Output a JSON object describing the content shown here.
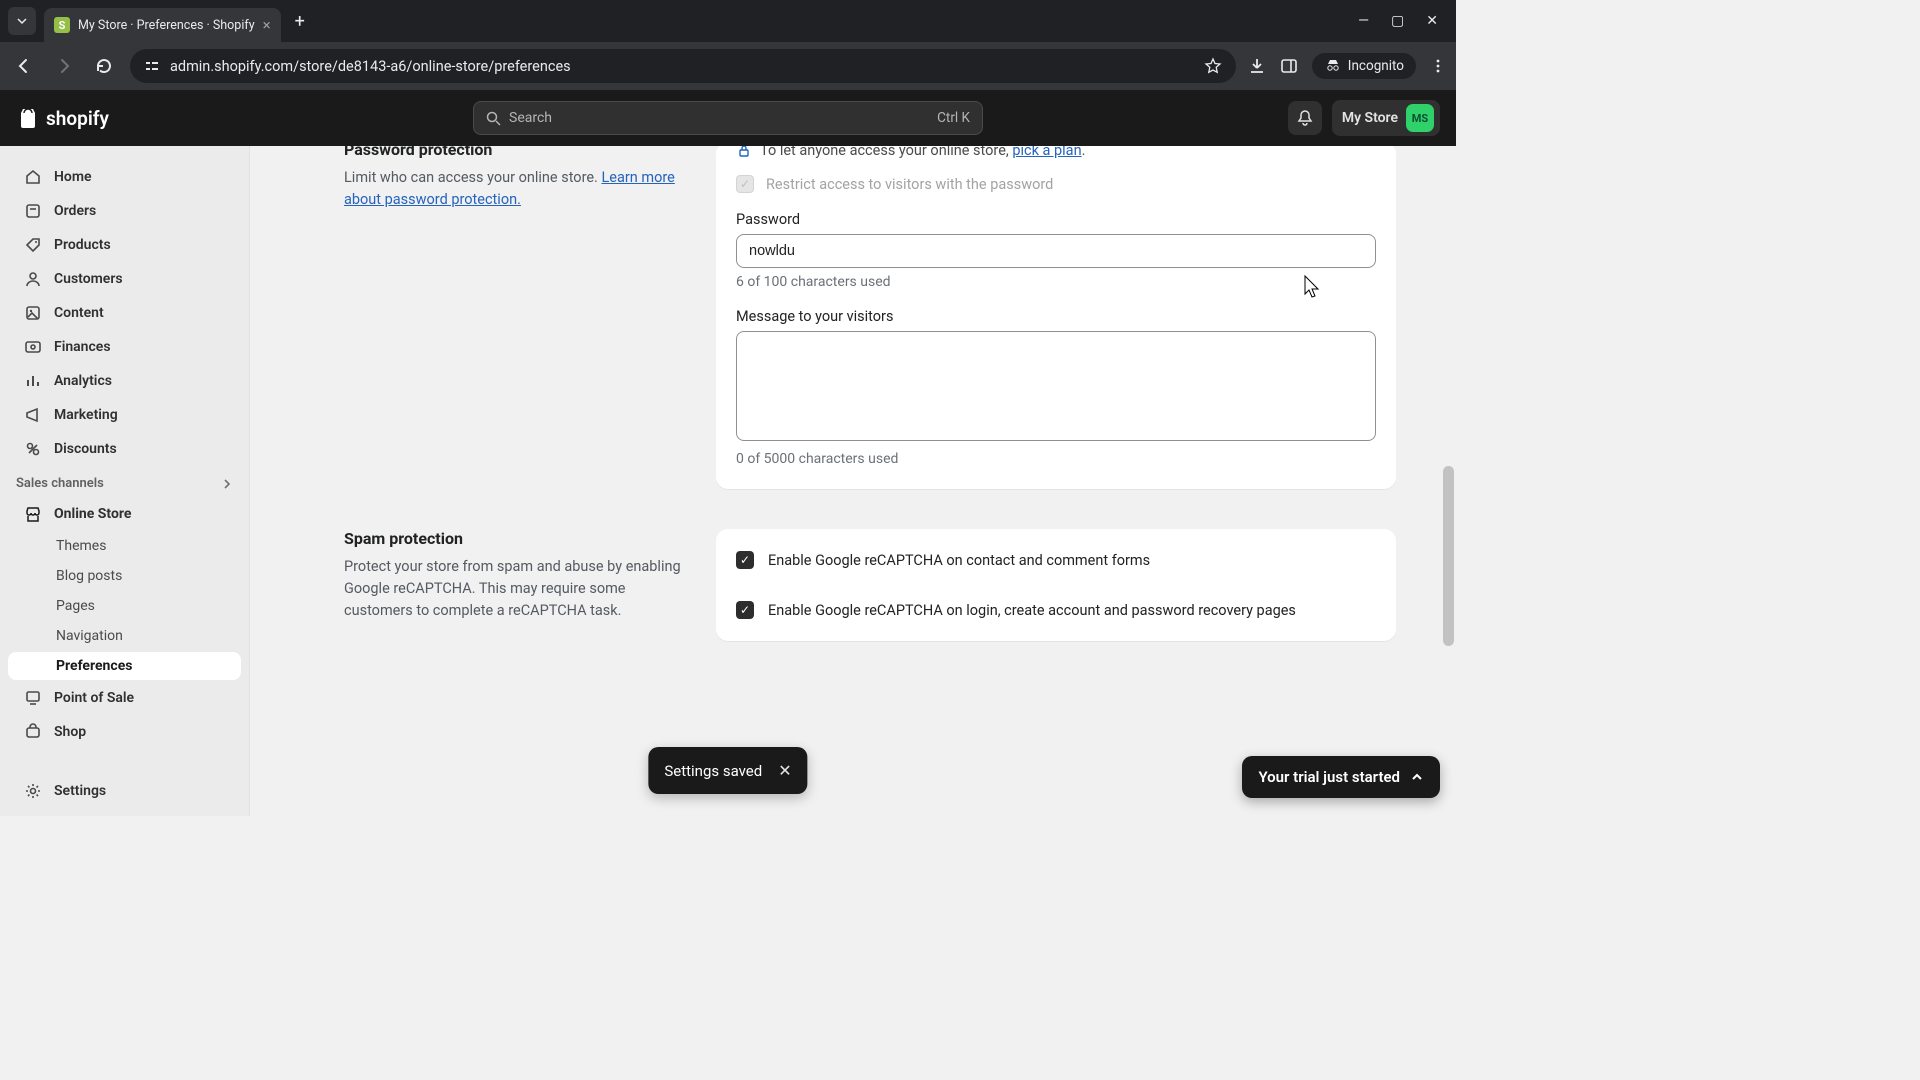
{
  "browser": {
    "tab_title": "My Store · Preferences · Shopify",
    "url": "admin.shopify.com/store/de8143-a6/online-store/preferences",
    "incognito": "Incognito"
  },
  "appbar": {
    "brand": "shopify",
    "search_placeholder": "Search",
    "search_kbd": "Ctrl K",
    "store_name": "My Store",
    "store_initials": "MS"
  },
  "sidebar": {
    "items": [
      {
        "label": "Home"
      },
      {
        "label": "Orders"
      },
      {
        "label": "Products"
      },
      {
        "label": "Customers"
      },
      {
        "label": "Content"
      },
      {
        "label": "Finances"
      },
      {
        "label": "Analytics"
      },
      {
        "label": "Marketing"
      },
      {
        "label": "Discounts"
      }
    ],
    "channels_header": "Sales channels",
    "online_store": "Online Store",
    "subitems": [
      {
        "label": "Themes"
      },
      {
        "label": "Blog posts"
      },
      {
        "label": "Pages"
      },
      {
        "label": "Navigation"
      },
      {
        "label": "Preferences"
      }
    ],
    "pos": "Point of Sale",
    "shop": "Shop",
    "settings": "Settings"
  },
  "password_section": {
    "title": "Password protection",
    "desc_prefix": "Limit who can access your online store. ",
    "desc_link": "Learn more about password protection.",
    "banner_prefix": "To let anyone access your online store, ",
    "banner_link": "pick a plan",
    "banner_suffix": ".",
    "restrict_label": "Restrict access to visitors with the password",
    "password_label": "Password",
    "password_value": "nowldu",
    "password_helper": "6 of 100 characters used",
    "message_label": "Message to your visitors",
    "message_value": "",
    "message_helper": "0 of 5000 characters used"
  },
  "spam_section": {
    "title": "Spam protection",
    "desc": "Protect your store from spam and abuse by enabling Google reCAPTCHA. This may require some customers to complete a reCAPTCHA task.",
    "check1": "Enable Google reCAPTCHA on contact and comment forms",
    "check2": "Enable Google reCAPTCHA on login, create account and password recovery pages"
  },
  "toast": {
    "text": "Settings saved"
  },
  "trial": {
    "text": "Your trial just started"
  }
}
